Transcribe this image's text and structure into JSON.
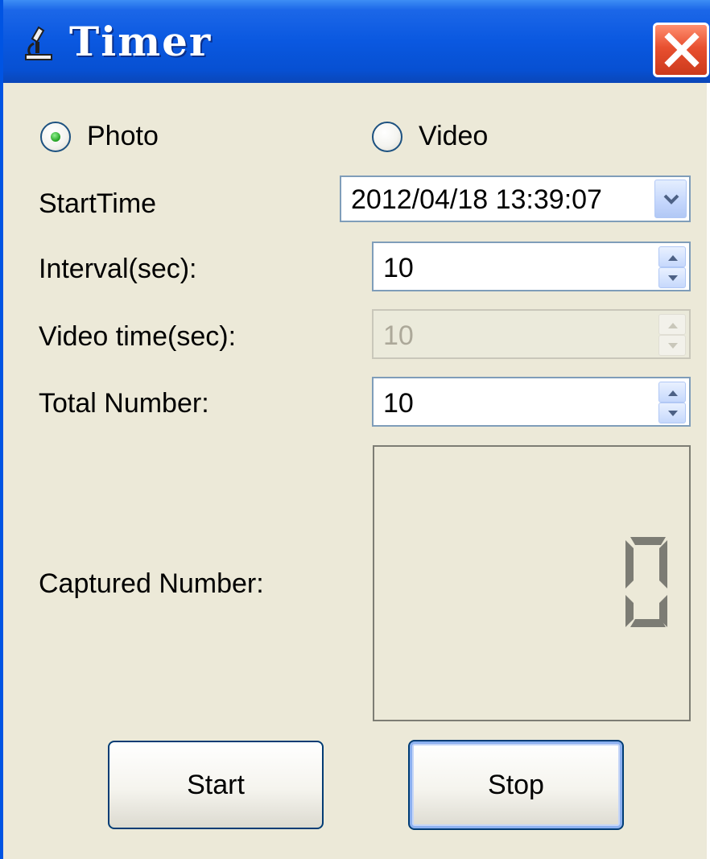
{
  "window": {
    "title": "Timer",
    "app_icon": "microscope-icon",
    "close_icon": "close-icon",
    "colors": {
      "titlebar": "#0a58e0",
      "close": "#e85030",
      "face": "#ece9d8",
      "field_border": "#7f9db9",
      "lcd": "#7c7c74"
    }
  },
  "mode": {
    "options": [
      {
        "label": "Photo",
        "selected": true
      },
      {
        "label": "Video",
        "selected": false
      }
    ]
  },
  "form": {
    "start_time": {
      "label": "StartTime",
      "value": "2012/04/18 13:39:07",
      "icon": "chevron-down-icon"
    },
    "interval": {
      "label": "Interval(sec):",
      "value": "10",
      "enabled": true
    },
    "video_time": {
      "label": "Video time(sec):",
      "value": "10",
      "enabled": false
    },
    "total_number": {
      "label": "Total Number:",
      "value": "10",
      "enabled": true
    },
    "captured_number": {
      "label": "Captured Number:",
      "value": "0"
    }
  },
  "buttons": {
    "start_label": "Start",
    "stop_label": "Stop"
  }
}
